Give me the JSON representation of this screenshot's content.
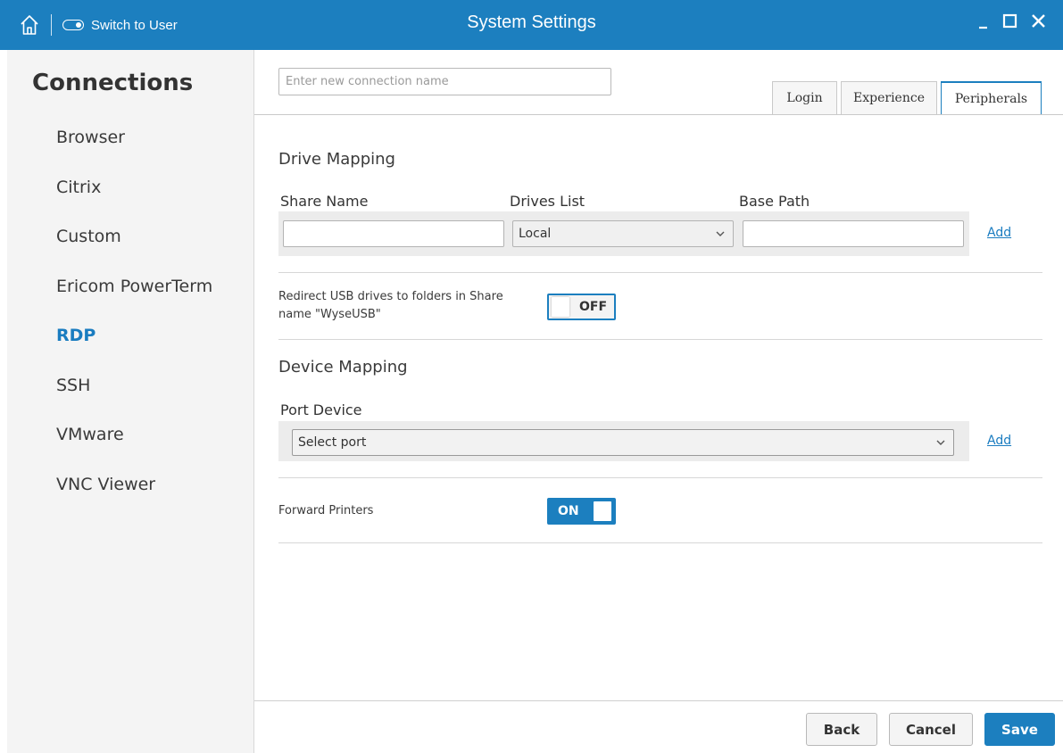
{
  "titlebar": {
    "title": "System Settings",
    "switch_label": "Switch to User",
    "icons": [
      "home-icon",
      "toggle-icon",
      "minimize-icon",
      "maximize-icon",
      "close-icon"
    ]
  },
  "sidebar": {
    "heading": "Connections",
    "items": [
      {
        "label": "Browser"
      },
      {
        "label": "Citrix"
      },
      {
        "label": "Custom"
      },
      {
        "label": "Ericom PowerTerm"
      },
      {
        "label": "RDP",
        "active": true
      },
      {
        "label": "SSH"
      },
      {
        "label": "VMware"
      },
      {
        "label": "VNC Viewer"
      }
    ]
  },
  "connection_name": {
    "value": "",
    "placeholder": "Enter new connection name"
  },
  "tabs": [
    {
      "label": "Login"
    },
    {
      "label": "Experience"
    },
    {
      "label": "Peripherals",
      "active": true
    }
  ],
  "drive_mapping": {
    "heading": "Drive Mapping",
    "columns": {
      "share": "Share Name",
      "drives": "Drives List",
      "base": "Base Path"
    },
    "share_value": "",
    "drives_value": "Local",
    "base_value": "",
    "add_label": "Add"
  },
  "usb_redirect": {
    "label": "Redirect USB drives to folders in Share name \"WyseUSB\"",
    "state": "OFF"
  },
  "device_mapping": {
    "heading": "Device Mapping",
    "port_label": "Port Device",
    "port_value": "Select port",
    "add_label": "Add"
  },
  "forward_printers": {
    "label": "Forward Printers",
    "state": "ON"
  },
  "footer": {
    "back": "Back",
    "cancel": "Cancel",
    "save": "Save"
  },
  "colors": {
    "accent": "#1c7fbf",
    "link": "#1a7cc0",
    "sidebar_bg": "#f4f4f4"
  }
}
